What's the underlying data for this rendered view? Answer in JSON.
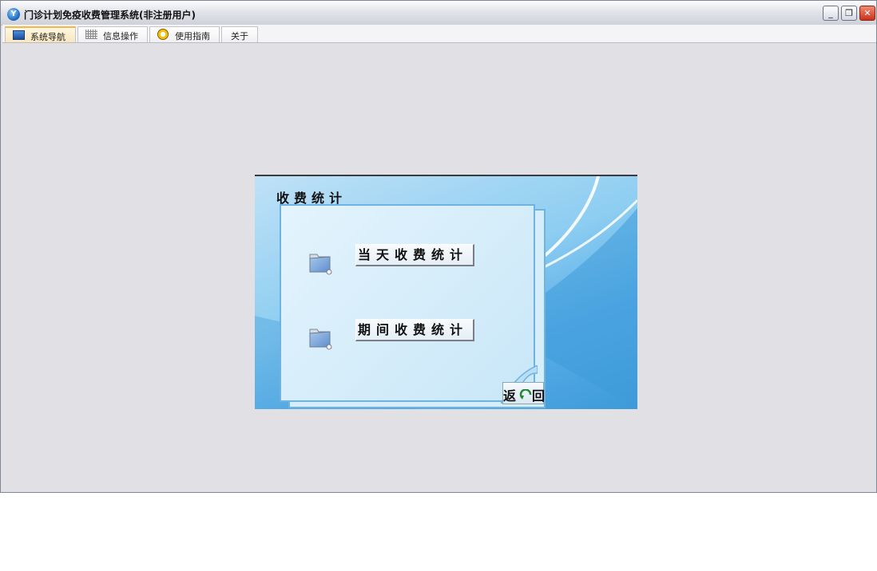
{
  "window": {
    "title": "门诊计划免疫收费管理系统(非注册用户)",
    "controls": {
      "minimize": "_",
      "maximize": "❐",
      "close": "✕"
    }
  },
  "tabs": [
    {
      "label": "系统导航",
      "icon": "monitor-icon",
      "active": true
    },
    {
      "label": "信息操作",
      "icon": "grid-icon",
      "active": false
    },
    {
      "label": "使用指南",
      "icon": "help-icon",
      "active": false
    },
    {
      "label": "关于",
      "icon": "",
      "active": false
    }
  ],
  "panel": {
    "title": "收费统计",
    "buttons": {
      "daily": "当天收费统计",
      "period": "期间收费统计"
    },
    "back": {
      "label_left": "返",
      "label_right": "回"
    }
  },
  "colors": {
    "accent_tab": "#f3b64a",
    "panel_blue": "#3d9ad8",
    "window_bg": "#e1e0e4"
  }
}
